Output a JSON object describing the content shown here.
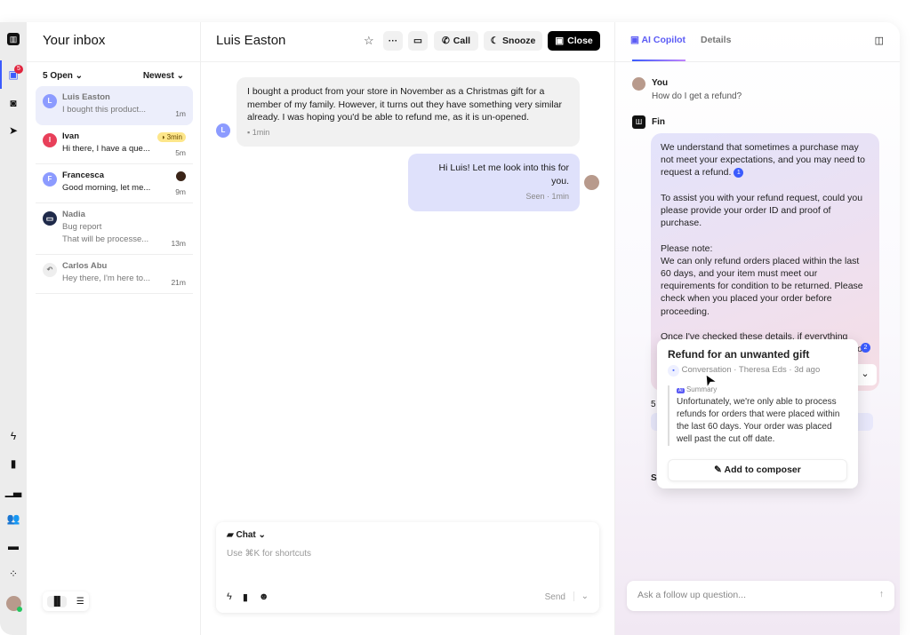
{
  "rail": {
    "badge_count": "5",
    "icons": [
      "logo-icon",
      "inbox-icon",
      "bot-icon",
      "send-icon",
      "bolt-icon",
      "book-icon",
      "chart-icon",
      "people-icon",
      "message-icon",
      "apps-icon"
    ]
  },
  "inbox": {
    "title": "Your inbox",
    "filter": "5 Open",
    "sort": "Newest",
    "items": [
      {
        "initial": "L",
        "name": "Luis Easton",
        "preview": "I bought this product...",
        "time": "1m",
        "color": "#8c9bff"
      },
      {
        "initial": "I",
        "name": "Ivan",
        "preview": "Hi there, I have a que...",
        "time": "5m",
        "sla": "3min",
        "color": "#e8405a"
      },
      {
        "initial": "F",
        "name": "Francesca",
        "preview": "Good morning, let me...",
        "time": "9m",
        "color": "#8c9bff"
      },
      {
        "name": "Nadia",
        "subject": "Bug report",
        "preview": "That will be processe...",
        "time": "13m",
        "color": "#1f2a4a"
      },
      {
        "name": "Carlos Abu",
        "preview": "Hey there, I'm here to...",
        "time": "21m"
      }
    ]
  },
  "conversation": {
    "title": "Luis Easton",
    "actions": {
      "call": "Call",
      "snooze": "Snooze",
      "close": "Close"
    },
    "messages": [
      {
        "initial": "L",
        "text": "I bought a product from your store in November as a Christmas gift for a member of my family. However, it turns out they have something very similar already. I was hoping you'd be able to refund me, as it is un-opened.",
        "meta": "1min"
      },
      {
        "text": "Hi Luis! Let me look into this for you.",
        "meta": "Seen · 1min"
      }
    ],
    "composer": {
      "mode": "Chat",
      "placeholder": "Use ⌘K for shortcuts",
      "send": "Send"
    }
  },
  "copilot": {
    "tabs": [
      "AI Copilot",
      "Details"
    ],
    "you_label": "You",
    "question": "How do I get a refund?",
    "fin_label": "Fin",
    "answer": [
      "We understand that sometimes a purchase may not meet your expectations, and you may need to request a refund.",
      "To assist you with your refund request, could you please provide your order ID and proof of purchase.",
      "Please note:",
      "We can only refund orders placed within the last 60 days, and your item must meet our requirements for condition to be returned. Please check when you placed your order before proceeding.",
      "Once I've checked these details, if everything looks OK, I will send a returns QR code which you can use to post the item back to us. Your refund will be"
    ],
    "ref1": "1",
    "ref2": "2",
    "hidden_a": "5",
    "hidden_b": "S",
    "ask_placeholder": "Ask a follow up question...",
    "popover": {
      "title": "Refund for an unwanted gift",
      "meta": "Conversation · Theresa Eds · 3d ago",
      "summary_label": "Summary",
      "summary": "Unfortunately, we're only able to process refunds for orders that were placed within the last 60 days. Your order was placed well past the cut off date.",
      "button": "Add to composer"
    }
  },
  "colors": {
    "accent": "#3b5bfd",
    "close_button": "#000000",
    "sla_badge": "#fde68a"
  }
}
